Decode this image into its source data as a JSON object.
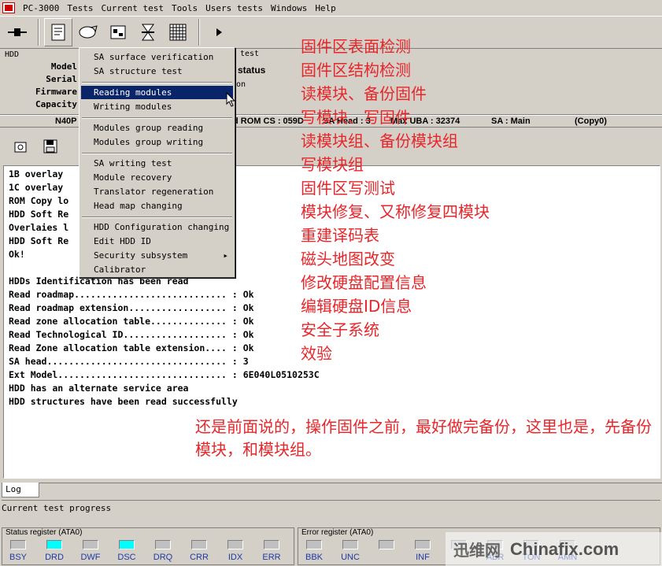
{
  "menubar": {
    "items": [
      "PC-3000",
      "Tests",
      "Current test",
      "Tools",
      "Users tests",
      "Windows",
      "Help"
    ]
  },
  "hdd": {
    "label": "HDD",
    "fields": [
      "Model",
      "Serial",
      "Firmware",
      "Capacity"
    ],
    "right_texts": [
      "test",
      "status",
      "on"
    ]
  },
  "inforow": {
    "model": "N40P",
    "rom": "d ROM CS : 059D",
    "sa_head": "SA Head : 3",
    "max_lba": "Max UBA : 32374",
    "sa": "SA : Main",
    "copy": "(Copy0)"
  },
  "dropdown": {
    "items": [
      {
        "label": "SA surface verification"
      },
      {
        "label": "SA structure test"
      },
      {
        "label": "Reading modules",
        "selected": true
      },
      {
        "label": "Writing modules"
      },
      {
        "label": "Modules group reading"
      },
      {
        "label": "Modules group writing"
      },
      {
        "label": "SA writing test"
      },
      {
        "label": "Module recovery"
      },
      {
        "label": "Translator regeneration"
      },
      {
        "label": "Head map changing"
      },
      {
        "label": "HDD Configuration changing"
      },
      {
        "label": "Edit HDD ID"
      },
      {
        "label": "Security subsystem",
        "submenu": true
      },
      {
        "label": "Calibrator"
      }
    ]
  },
  "log": {
    "lines": [
      "1B overlay",
      "1C overlay",
      "ROM Copy lo",
      "HDD Soft Re",
      "Overlaies l",
      "HDD Soft Re",
      "Ok!",
      "",
      "HDDs Identification has been read",
      "Read roadmap............................ : Ok",
      "Read roadmap extension.................. : Ok",
      "Read zone allocation table.............. : Ok",
      "Read Technological ID................... : Ok",
      "Read Zone allocation table extension.... : Ok",
      "SA head................................. : 3",
      "Ext Model............................... : 6E040L0510253C",
      "HDD has an alternate service area",
      "HDD structures have been read successfully"
    ],
    "tab": "Log",
    "progress_label": "Current test progress"
  },
  "status_register": {
    "label": "Status register (ATA0)",
    "bits": [
      {
        "name": "BSY",
        "on": false
      },
      {
        "name": "DRD",
        "on": true
      },
      {
        "name": "DWF",
        "on": false
      },
      {
        "name": "DSC",
        "on": true
      },
      {
        "name": "DRQ",
        "on": false
      },
      {
        "name": "CRR",
        "on": false
      },
      {
        "name": "IDX",
        "on": false
      },
      {
        "name": "ERR",
        "on": false
      }
    ]
  },
  "error_register": {
    "label": "Error register (ATA0)",
    "bits": [
      {
        "name": "BBK",
        "on": false
      },
      {
        "name": "UNC",
        "on": false
      },
      {
        "name": "",
        "on": false
      },
      {
        "name": "INF",
        "on": false
      },
      {
        "name": "",
        "on": false
      },
      {
        "name": "ABR",
        "on": false
      },
      {
        "name": "TON",
        "on": false
      },
      {
        "name": "AMN",
        "on": false
      }
    ]
  },
  "notes": [
    "固件区表面检测",
    "固件区结构检测",
    "读模块、备份固件",
    "写模块、写固件",
    "读模块组、备份模块组",
    "写模块组",
    "固件区写测试",
    "模块修复、又称修复四模块",
    "重建译码表",
    "磁头地图改变",
    "修改硬盘配置信息",
    "编辑硬盘ID信息",
    "安全子系统",
    "效验"
  ],
  "bignote": "还是前面说的，操作固件之前，最好做完备份，这里也是，先备份模块，和模块组。",
  "watermark": {
    "cn": "迅维网",
    "en": "Chinafix.com"
  }
}
